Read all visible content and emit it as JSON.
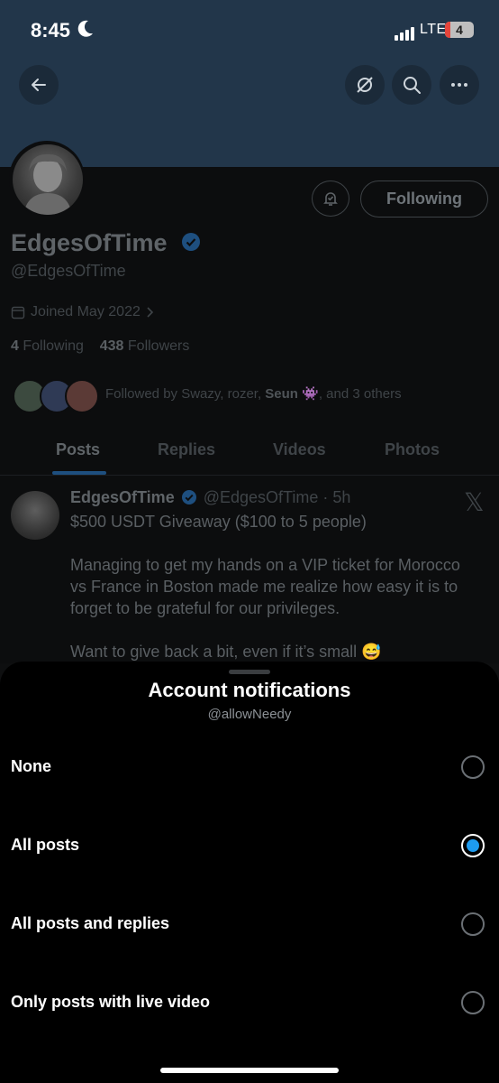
{
  "status_bar": {
    "time": "8:45",
    "network": "LTE",
    "battery": "4"
  },
  "header": {
    "back_icon": "back-arrow-icon",
    "actions": [
      "no-location-icon",
      "search-icon",
      "more-icon"
    ]
  },
  "profile": {
    "name": "EdgesOfTime",
    "handle": "@EdgesOfTime",
    "joined": "Joined May 2022",
    "following_count": "4",
    "following_label": "Following",
    "followers_count": "438",
    "followers_label": "Followers",
    "followed_by_prefix": "Followed by Swazy, rozer,",
    "followed_by_bold": "Seun",
    "followed_by_suffix": ", and 3 others",
    "follow_button": "Following"
  },
  "tabs": [
    "Posts",
    "Replies",
    "Videos",
    "Photos"
  ],
  "post": {
    "name": "EdgesOfTime",
    "handle_time": "@EdgesOfTime · 5h",
    "line1": "$500 USDT Giveaway ($100 to 5 people)",
    "para1_l1": "Managing to get my hands on a VIP ticket for Morocco",
    "para1_l2": "vs France in Boston made me realize how easy it is to",
    "para1_l3": "forget to be grateful for our privileges.",
    "para2": "Want to give back a bit, even if it’s small 😅"
  },
  "sheet": {
    "title": "Account notifications",
    "subtitle": "@allowNeedy",
    "options": [
      {
        "label": "None",
        "selected": false
      },
      {
        "label": "All posts",
        "selected": true
      },
      {
        "label": "All posts and replies",
        "selected": false
      },
      {
        "label": "Only posts with live video",
        "selected": false
      }
    ]
  },
  "colors": {
    "accent": "#1d9bf0",
    "sheet_bg": "#000000",
    "banner": "#22364a"
  }
}
